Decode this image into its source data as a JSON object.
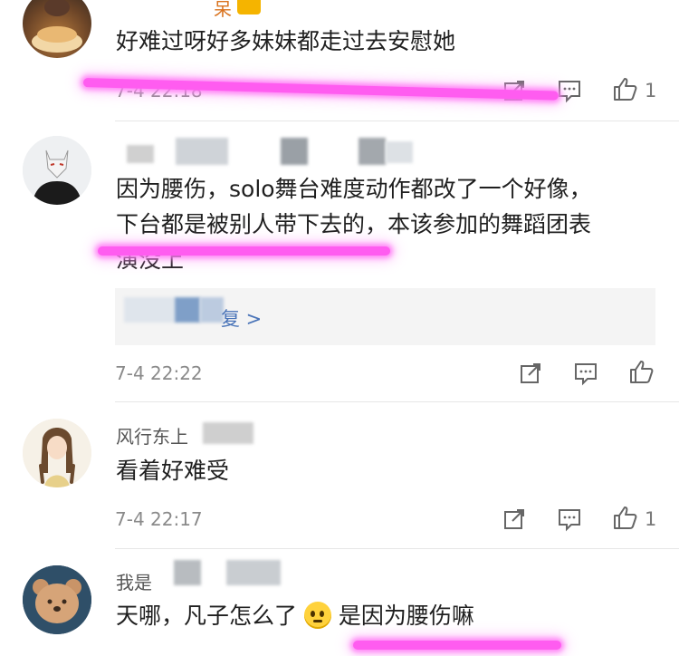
{
  "comments": [
    {
      "name_fragment": "呆",
      "text": "好难过呀好多妹妹都走过去安慰她",
      "time": "7-4 22:18",
      "likes": "1"
    },
    {
      "text_line1": "因为腰伤，solo舞台难度动作都改了一个好像，",
      "text_line2": "下台都是被别人带下去的，本该参加的舞蹈团表",
      "text_line3": "演没上",
      "reply_link": "复 >",
      "time": "7-4 22:22"
    },
    {
      "name_fragment": "风行东上",
      "text": "看着好难受",
      "time": "7-4 22:17",
      "likes": "1"
    },
    {
      "name_fragment": "我是",
      "text_before_emoji": "天哪，凡子怎么了",
      "text_after_emoji": "是因为腰伤嘛"
    }
  ],
  "icons": {
    "share": "share-icon",
    "comment": "comment-icon",
    "like": "thumbs-up-icon",
    "emoji": "pleading-face-emoji"
  },
  "colors": {
    "highlight": "#ff5cf0",
    "link": "#4a74b8",
    "time": "#8a8a8a"
  }
}
